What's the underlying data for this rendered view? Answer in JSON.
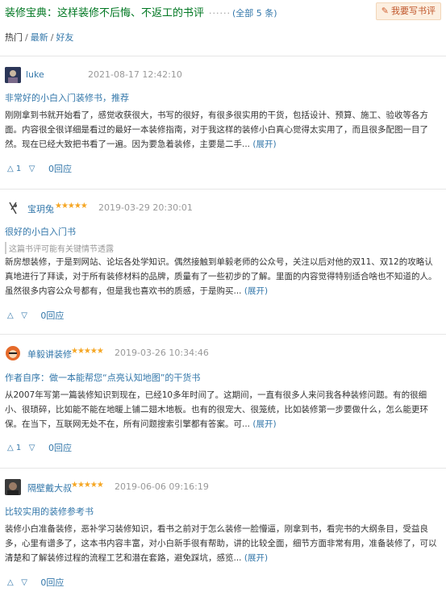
{
  "header": {
    "title": "装修宝典：这样装修不后悔、不返工的书评",
    "dots": "······",
    "count": "(全部 5 条)",
    "write_button": "我要写书评"
  },
  "sort": {
    "hot": "热门",
    "sep1": "/",
    "latest": "最新",
    "sep2": "/",
    "friends": "好友"
  },
  "reviews": [
    {
      "author": "luke",
      "stars": "",
      "time": "2021-08-17 12:42:10",
      "title": "非常好的小白入门装修书，推荐",
      "spoiler": "",
      "body": "刚刚拿到书就开始看了，感觉收获很大，书写的很好，有很多很实用的干货，包括设计、预算、施工、验收等各方面。内容很全很详细是看过的最好一本装修指南，对于我这样的装修小白真心觉得太实用了，而且很多配图一目了然。现在已经大致把书看了一遍。因为要急着装修，主要是二手...",
      "expand": "(展开)",
      "up": "1",
      "down": "",
      "replies": "0回应"
    },
    {
      "author": "宝玥兔",
      "stars": "★★★★★",
      "time": "2019-03-29 20:30:01",
      "title": "很好的小白入门书",
      "spoiler": "这篇书评可能有关键情节透露",
      "body": "新房想装修，于是到网站、论坛各处学知识。偶然接触到单毅老师的公众号，关注以后对他的双11、双12的攻略认真地进行了拜读，对于所有装修材料的品牌，质量有了一些初步的了解。里面的内容觉得特别适合啥也不知道的人。虽然很多内容公众号都有，但是我也喜欢书的质感，于是购买...",
      "expand": "(展开)",
      "up": "",
      "down": "",
      "replies": "0回应"
    },
    {
      "author": "单毅讲装修",
      "stars": "★★★★★",
      "time": "2019-03-26 10:34:46",
      "title": "作者自序：做一本能帮您“点亮认知地图”的干货书",
      "spoiler": "",
      "body": "从2007年写第一篇装修知识到现在，已经10多年时间了。这期间，一直有很多人来问我各种装修问题。有的很细小、很琐碎，比如能不能在地暖上铺二翅木地板。也有的很宠大、很笼统，比如装修第一步要做什么，怎么能更环保。在当下，互联网无处不在，所有问题搜索引擎都有答案。可...",
      "expand": "(展开)",
      "up": "1",
      "down": "",
      "replies": "0回应"
    },
    {
      "author": "隔壁戴大叔",
      "stars": "★★★★★",
      "time": "2019-06-06 09:16:19",
      "title": "比较实用的装修参考书",
      "spoiler": "",
      "body": "装修小白准备装修，恶补学习装修知识，看书之前对于怎么装修一脸懵逼，刚拿到书，看完书的大纲条目，受益良多，心里有谱多了，这本书内容丰富，对小白新手很有帮助，讲的比较全面，细节方面非常有用，准备装修了，可以清楚和了解装修过程的流程工艺和潜在套路，避免踩坑，感览...",
      "expand": "(展开)",
      "up": "",
      "down": "",
      "replies": "0回应"
    }
  ],
  "icons": {
    "pen": "pen-icon",
    "up": "thumb-up-triangle-icon",
    "down": "thumb-down-triangle-icon"
  },
  "colors": {
    "link": "#3377aa",
    "title_green": "#007722",
    "star": "#f5a623",
    "button_bg": "#fcefe0"
  }
}
